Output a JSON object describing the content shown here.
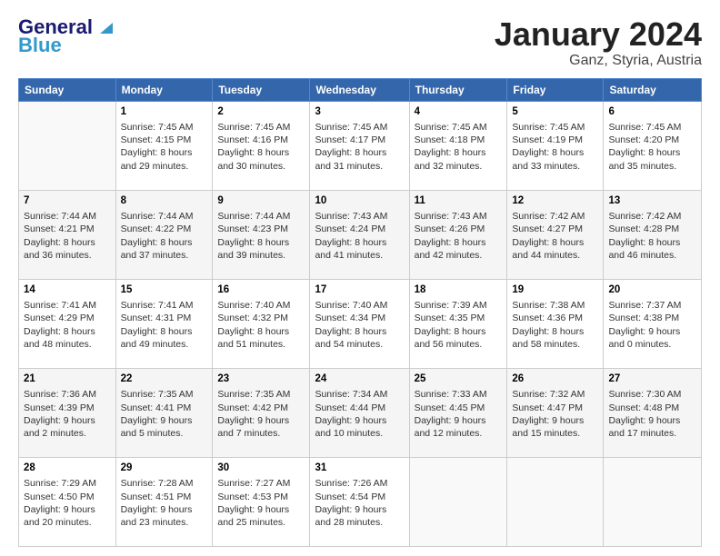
{
  "header": {
    "logo_line1": "General",
    "logo_line2": "Blue",
    "title": "January 2024",
    "subtitle": "Ganz, Styria, Austria"
  },
  "weekdays": [
    "Sunday",
    "Monday",
    "Tuesday",
    "Wednesday",
    "Thursday",
    "Friday",
    "Saturday"
  ],
  "weeks": [
    [
      {
        "day": "",
        "sunrise": "",
        "sunset": "",
        "daylight": ""
      },
      {
        "day": "1",
        "sunrise": "Sunrise: 7:45 AM",
        "sunset": "Sunset: 4:15 PM",
        "daylight": "Daylight: 8 hours and 29 minutes."
      },
      {
        "day": "2",
        "sunrise": "Sunrise: 7:45 AM",
        "sunset": "Sunset: 4:16 PM",
        "daylight": "Daylight: 8 hours and 30 minutes."
      },
      {
        "day": "3",
        "sunrise": "Sunrise: 7:45 AM",
        "sunset": "Sunset: 4:17 PM",
        "daylight": "Daylight: 8 hours and 31 minutes."
      },
      {
        "day": "4",
        "sunrise": "Sunrise: 7:45 AM",
        "sunset": "Sunset: 4:18 PM",
        "daylight": "Daylight: 8 hours and 32 minutes."
      },
      {
        "day": "5",
        "sunrise": "Sunrise: 7:45 AM",
        "sunset": "Sunset: 4:19 PM",
        "daylight": "Daylight: 8 hours and 33 minutes."
      },
      {
        "day": "6",
        "sunrise": "Sunrise: 7:45 AM",
        "sunset": "Sunset: 4:20 PM",
        "daylight": "Daylight: 8 hours and 35 minutes."
      }
    ],
    [
      {
        "day": "7",
        "sunrise": "Sunrise: 7:44 AM",
        "sunset": "Sunset: 4:21 PM",
        "daylight": "Daylight: 8 hours and 36 minutes."
      },
      {
        "day": "8",
        "sunrise": "Sunrise: 7:44 AM",
        "sunset": "Sunset: 4:22 PM",
        "daylight": "Daylight: 8 hours and 37 minutes."
      },
      {
        "day": "9",
        "sunrise": "Sunrise: 7:44 AM",
        "sunset": "Sunset: 4:23 PM",
        "daylight": "Daylight: 8 hours and 39 minutes."
      },
      {
        "day": "10",
        "sunrise": "Sunrise: 7:43 AM",
        "sunset": "Sunset: 4:24 PM",
        "daylight": "Daylight: 8 hours and 41 minutes."
      },
      {
        "day": "11",
        "sunrise": "Sunrise: 7:43 AM",
        "sunset": "Sunset: 4:26 PM",
        "daylight": "Daylight: 8 hours and 42 minutes."
      },
      {
        "day": "12",
        "sunrise": "Sunrise: 7:42 AM",
        "sunset": "Sunset: 4:27 PM",
        "daylight": "Daylight: 8 hours and 44 minutes."
      },
      {
        "day": "13",
        "sunrise": "Sunrise: 7:42 AM",
        "sunset": "Sunset: 4:28 PM",
        "daylight": "Daylight: 8 hours and 46 minutes."
      }
    ],
    [
      {
        "day": "14",
        "sunrise": "Sunrise: 7:41 AM",
        "sunset": "Sunset: 4:29 PM",
        "daylight": "Daylight: 8 hours and 48 minutes."
      },
      {
        "day": "15",
        "sunrise": "Sunrise: 7:41 AM",
        "sunset": "Sunset: 4:31 PM",
        "daylight": "Daylight: 8 hours and 49 minutes."
      },
      {
        "day": "16",
        "sunrise": "Sunrise: 7:40 AM",
        "sunset": "Sunset: 4:32 PM",
        "daylight": "Daylight: 8 hours and 51 minutes."
      },
      {
        "day": "17",
        "sunrise": "Sunrise: 7:40 AM",
        "sunset": "Sunset: 4:34 PM",
        "daylight": "Daylight: 8 hours and 54 minutes."
      },
      {
        "day": "18",
        "sunrise": "Sunrise: 7:39 AM",
        "sunset": "Sunset: 4:35 PM",
        "daylight": "Daylight: 8 hours and 56 minutes."
      },
      {
        "day": "19",
        "sunrise": "Sunrise: 7:38 AM",
        "sunset": "Sunset: 4:36 PM",
        "daylight": "Daylight: 8 hours and 58 minutes."
      },
      {
        "day": "20",
        "sunrise": "Sunrise: 7:37 AM",
        "sunset": "Sunset: 4:38 PM",
        "daylight": "Daylight: 9 hours and 0 minutes."
      }
    ],
    [
      {
        "day": "21",
        "sunrise": "Sunrise: 7:36 AM",
        "sunset": "Sunset: 4:39 PM",
        "daylight": "Daylight: 9 hours and 2 minutes."
      },
      {
        "day": "22",
        "sunrise": "Sunrise: 7:35 AM",
        "sunset": "Sunset: 4:41 PM",
        "daylight": "Daylight: 9 hours and 5 minutes."
      },
      {
        "day": "23",
        "sunrise": "Sunrise: 7:35 AM",
        "sunset": "Sunset: 4:42 PM",
        "daylight": "Daylight: 9 hours and 7 minutes."
      },
      {
        "day": "24",
        "sunrise": "Sunrise: 7:34 AM",
        "sunset": "Sunset: 4:44 PM",
        "daylight": "Daylight: 9 hours and 10 minutes."
      },
      {
        "day": "25",
        "sunrise": "Sunrise: 7:33 AM",
        "sunset": "Sunset: 4:45 PM",
        "daylight": "Daylight: 9 hours and 12 minutes."
      },
      {
        "day": "26",
        "sunrise": "Sunrise: 7:32 AM",
        "sunset": "Sunset: 4:47 PM",
        "daylight": "Daylight: 9 hours and 15 minutes."
      },
      {
        "day": "27",
        "sunrise": "Sunrise: 7:30 AM",
        "sunset": "Sunset: 4:48 PM",
        "daylight": "Daylight: 9 hours and 17 minutes."
      }
    ],
    [
      {
        "day": "28",
        "sunrise": "Sunrise: 7:29 AM",
        "sunset": "Sunset: 4:50 PM",
        "daylight": "Daylight: 9 hours and 20 minutes."
      },
      {
        "day": "29",
        "sunrise": "Sunrise: 7:28 AM",
        "sunset": "Sunset: 4:51 PM",
        "daylight": "Daylight: 9 hours and 23 minutes."
      },
      {
        "day": "30",
        "sunrise": "Sunrise: 7:27 AM",
        "sunset": "Sunset: 4:53 PM",
        "daylight": "Daylight: 9 hours and 25 minutes."
      },
      {
        "day": "31",
        "sunrise": "Sunrise: 7:26 AM",
        "sunset": "Sunset: 4:54 PM",
        "daylight": "Daylight: 9 hours and 28 minutes."
      },
      {
        "day": "",
        "sunrise": "",
        "sunset": "",
        "daylight": ""
      },
      {
        "day": "",
        "sunrise": "",
        "sunset": "",
        "daylight": ""
      },
      {
        "day": "",
        "sunrise": "",
        "sunset": "",
        "daylight": ""
      }
    ]
  ]
}
